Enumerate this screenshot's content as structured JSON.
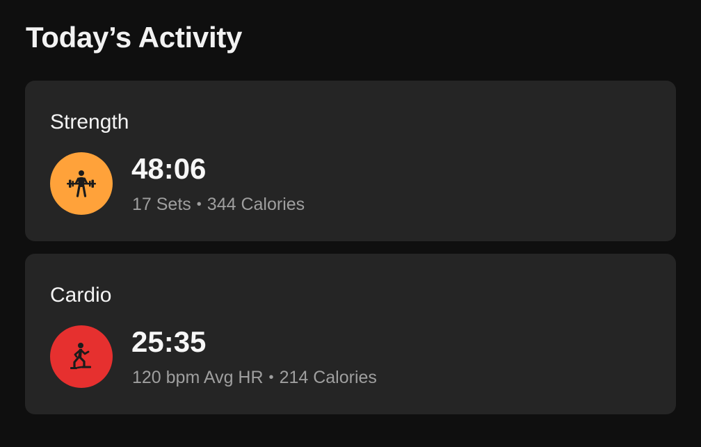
{
  "page": {
    "title": "Today’s Activity"
  },
  "theme": {
    "background": "#0f0f0f",
    "card_background": "#252525",
    "primary_text": "#ffffff",
    "secondary_text": "#9f9f9f"
  },
  "activities": [
    {
      "name": "Strength",
      "icon": "weightlifting-icon",
      "icon_color": "#ffa23a",
      "duration": "48:06",
      "stat_primary": "17 Sets",
      "separator": "•",
      "stat_secondary": "344 Calories"
    },
    {
      "name": "Cardio",
      "icon": "stair-climber-icon",
      "icon_color": "#e6302f",
      "duration": "25:35",
      "stat_primary": "120 bpm Avg HR",
      "separator": "•",
      "stat_secondary": "214 Calories"
    }
  ]
}
